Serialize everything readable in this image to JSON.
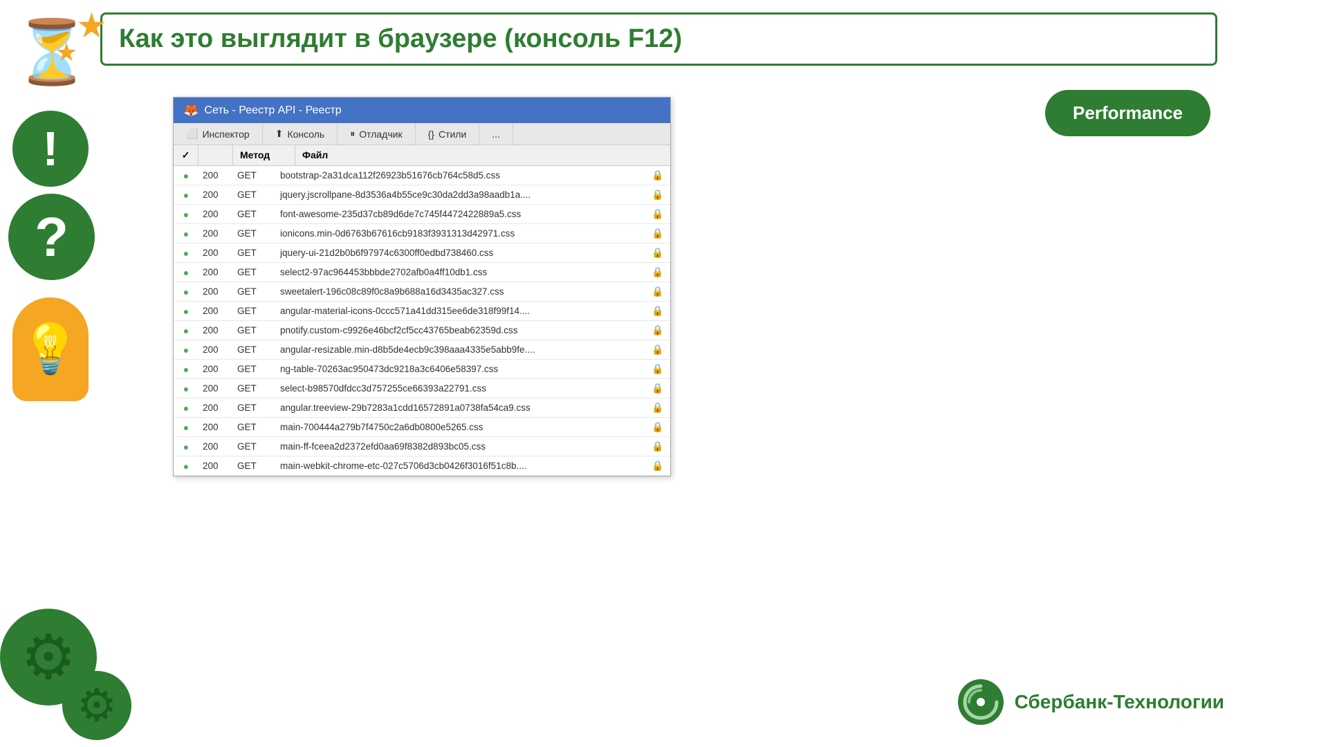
{
  "header": {
    "title": "Как это выглядит в браузере (консоль F12)"
  },
  "performance_badge": "Performance",
  "browser": {
    "titlebar": "Сеть - Реестр API - Реестр",
    "tabs": [
      {
        "label": "Инспектор",
        "icon": "⬜",
        "active": false
      },
      {
        "label": "Консоль",
        "icon": "⬆",
        "active": false
      },
      {
        "label": "Отладчик",
        "icon": "⏸",
        "active": false
      },
      {
        "label": "Стили",
        "icon": "{}",
        "active": false
      }
    ],
    "table_headers": {
      "check": "✓",
      "method": "Метод",
      "file": "Файл"
    },
    "rows": [
      {
        "code": "200",
        "method": "GET",
        "file": "bootstrap-2a31dca112f26923b51676cb764c58d5.css"
      },
      {
        "code": "200",
        "method": "GET",
        "file": "jquery.jscrollpane-8d3536a4b55ce9c30da2dd3a98aadb1a...."
      },
      {
        "code": "200",
        "method": "GET",
        "file": "font-awesome-235d37cb89d6de7c745f4472422889a5.css"
      },
      {
        "code": "200",
        "method": "GET",
        "file": "ionicons.min-0d6763b67616cb9183f3931313d42971.css"
      },
      {
        "code": "200",
        "method": "GET",
        "file": "jquery-ui-21d2b0b6f97974c6300ff0edbd738460.css"
      },
      {
        "code": "200",
        "method": "GET",
        "file": "select2-97ac964453bbbde2702afb0a4ff10db1.css"
      },
      {
        "code": "200",
        "method": "GET",
        "file": "sweetalert-196c08c89f0c8a9b688a16d3435ac327.css"
      },
      {
        "code": "200",
        "method": "GET",
        "file": "angular-material-icons-0ccc571a41dd315ee6de318f99f14...."
      },
      {
        "code": "200",
        "method": "GET",
        "file": "pnotify.custom-c9926e46bcf2cf5cc43765beab62359d.css"
      },
      {
        "code": "200",
        "method": "GET",
        "file": "angular-resizable.min-d8b5de4ecb9c398aaa4335e5abb9fe...."
      },
      {
        "code": "200",
        "method": "GET",
        "file": "ng-table-70263ac950473dc9218a3c6406e58397.css"
      },
      {
        "code": "200",
        "method": "GET",
        "file": "select-b98570dfdcc3d757255ce66393a22791.css"
      },
      {
        "code": "200",
        "method": "GET",
        "file": "angular.treeview-29b7283a1cdd16572891a0738fa54ca9.css"
      },
      {
        "code": "200",
        "method": "GET",
        "file": "main-700444a279b7f4750c2a6db0800e5265.css"
      },
      {
        "code": "200",
        "method": "GET",
        "file": "main-ff-fceea2d2372efd0aa69f8382d893bc05.css"
      },
      {
        "code": "200",
        "method": "GET",
        "file": "main-webkit-chrome-etc-027c5706d3cb0426f3016f51c8b...."
      }
    ]
  },
  "sberbank": {
    "name": "Сбербанк-Технологии"
  }
}
